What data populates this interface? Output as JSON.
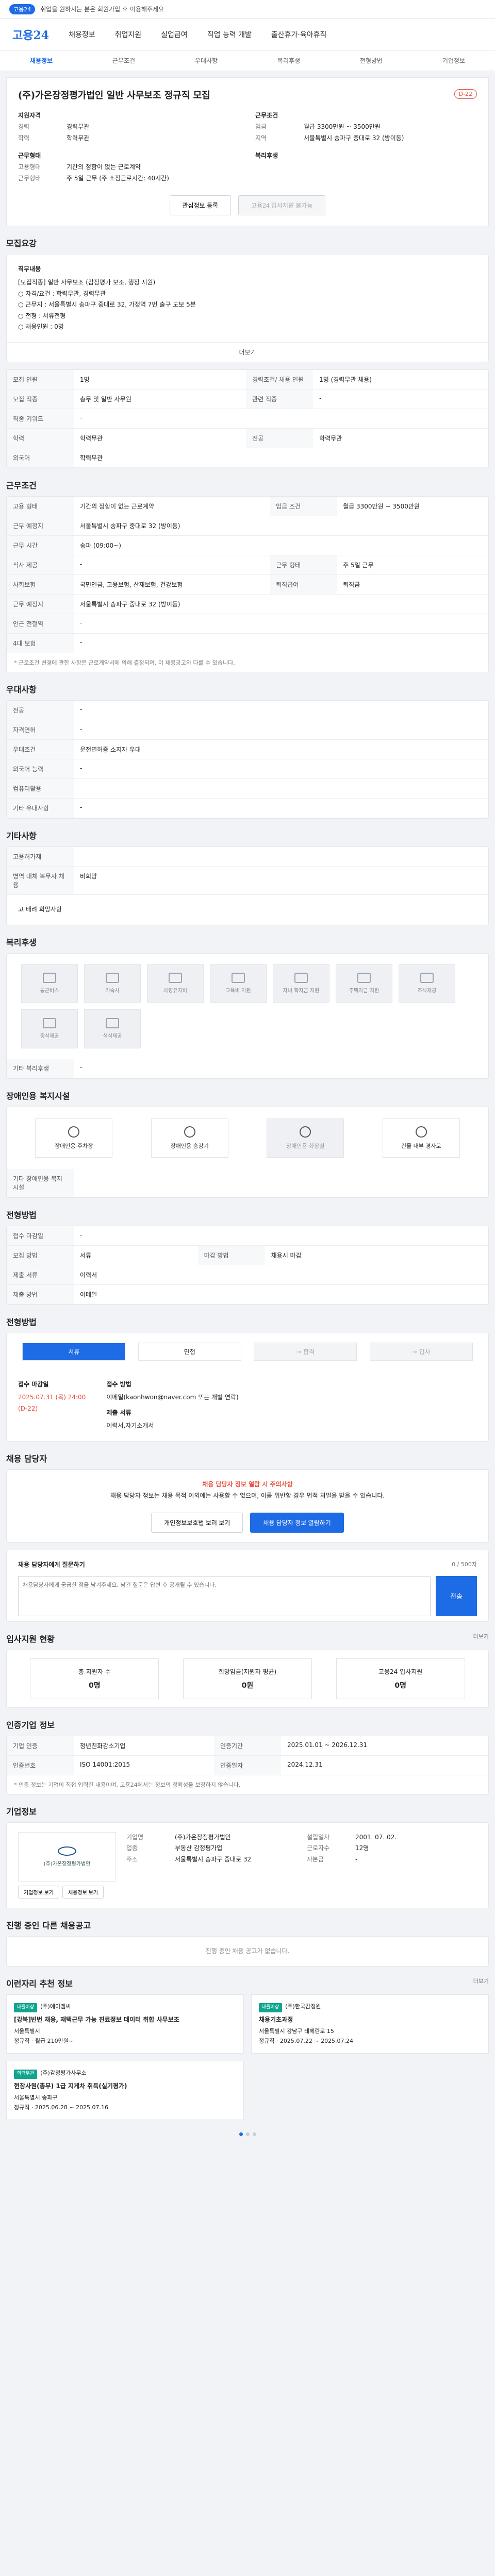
{
  "topbar": {
    "text": "취업을 원하시는 분은 회원가입 후 이용해주세요",
    "pill": "고용24"
  },
  "gnb": {
    "logo": "고용24",
    "menus": [
      "채용정보",
      "취업지원",
      "실업급여",
      "직업 능력 개발",
      "출산휴가·육아휴직"
    ]
  },
  "lnb": {
    "items": [
      "채용정보",
      "근무조건",
      "우대사항",
      "복리후생",
      "전형방법",
      "기업정보"
    ]
  },
  "hero": {
    "title": "(주)가온장정평가법인 일반 사무보조 정규직 모집",
    "dday": "D-22",
    "left_group1_title": "지원자격",
    "left_group1": [
      [
        "경력",
        "경력무관"
      ],
      [
        "학력",
        "학력무관"
      ]
    ],
    "left_group2_title": "근무형태",
    "left_group2": [
      [
        "고용형태",
        "기간의 정함이 없는 근로계약"
      ],
      [
        "근무형태",
        "주 5일 근무 (주 소정근로시간: 40시간)"
      ]
    ],
    "right_group1_title": "근무조건",
    "right_group1": [
      [
        "임금",
        "월급 3300만원 ~ 3500만원"
      ],
      [
        "지역",
        "서울특별시 송파구 중대로 32 (방이동)"
      ]
    ],
    "right_group2_title": "복리후생",
    "scrap_btn": "관심정보 등록",
    "apply_btn": "고용24 입사지원 불가능"
  },
  "job_desc": {
    "title": "모집요강",
    "heading": "직무내용",
    "lines": [
      "[모집직종] 일반 사무보조 (감정평가 보조, 행정 지원)",
      "○ 자격/요건 : 학력무관, 경력무관",
      "○ 근무지 : 서울특별시 송파구 중대로 32, 가정역 7번 출구 도보 5분",
      "○ 전형 : 서류전형",
      "○ 채용인원 : 0명"
    ],
    "more": "더보기"
  },
  "recruit_table": [
    [
      "모집 인원",
      "1명",
      "경력조건/ 채용 인원",
      "1명 (경력무관 채용)"
    ],
    [
      "모집 직종",
      "총무 및 일반 사무원",
      "관련 직종",
      "-"
    ],
    [
      "직종 키워드",
      "-",
      "",
      ""
    ],
    [
      "학력",
      "학력무관",
      "전공",
      "학력무관"
    ],
    [
      "외국어",
      "학력무관",
      "",
      ""
    ]
  ],
  "work_cond": {
    "title": "근무조건",
    "rows": [
      [
        "고용 형태",
        "기간의 정함이 없는 근로계약",
        "임금 조건",
        "월급 3300만원 ~ 3500만원"
      ],
      [
        "근무 예정지",
        "서울특별시 송파구 중대로 32 (방이동)",
        "",
        ""
      ],
      [
        "근무 시간",
        "송파 (09:00~)",
        "",
        ""
      ],
      [
        "식사 제공",
        "-",
        "근무 형태",
        "주 5일 근무"
      ],
      [
        "사회보험",
        "국민연금, 고용보험, 산재보험, 건강보험",
        "퇴직급여",
        "퇴직금"
      ],
      [
        "근무 예정지",
        "서울특별시 송파구 중대로 32 (방이동)",
        "",
        ""
      ],
      [
        "인근 전철역",
        "-",
        "",
        ""
      ],
      [
        "4대 보험",
        "-",
        "",
        ""
      ]
    ],
    "note": "* 근로조건 변경에 관한 사항은 근로계약서에 의해 결정되며, 이 채용공고와 다를 수 있습니다."
  },
  "pref": {
    "title": "우대사항",
    "rows": [
      [
        "전공",
        "-"
      ],
      [
        "자격면허",
        "-"
      ],
      [
        "우대조건",
        "운전면허증 소지자 우대"
      ],
      [
        "외국어 능력",
        "-"
      ],
      [
        "컴퓨터활용",
        "-"
      ],
      [
        "기타 우대사항",
        "-"
      ]
    ]
  },
  "etc": {
    "title": "기타사항",
    "rows": [
      [
        "고용허가제",
        "-"
      ],
      [
        "병역 대체 복무자 채용",
        "비희망"
      ]
    ],
    "handicap": "고 배려 희망사항"
  },
  "welfare": {
    "title": "복리후생",
    "items": [
      "통근버스",
      "기숙사",
      "차량유지비",
      "교육비 지원",
      "자녀 학자금 지원",
      "주택자금 지원",
      "조식제공",
      "중식제공",
      "석식제공"
    ],
    "other_label": "기타 복리후생",
    "other_value": "-"
  },
  "disabled": {
    "title": "장애인용 복지시설",
    "items": [
      "장애인용 주차장",
      "장애인용 승강기",
      "장애인용 화장실",
      "건물 내부 경사로"
    ],
    "other_label": "기타 장애인용 복지시설",
    "other_value": "-"
  },
  "selection": {
    "title": "전형방법",
    "rows": [
      [
        "접수 마감일",
        "-",
        "",
        ""
      ],
      [
        "모집 방법",
        "서류",
        "마감 방법",
        "채용시 마감"
      ],
      [
        "제출 서류",
        "이력서",
        "",
        ""
      ],
      [
        "제출 방법",
        "이메일",
        "",
        ""
      ]
    ]
  },
  "process": {
    "title": "전형방법",
    "steps": [
      "서류",
      "면접",
      "→ 합격 ",
      "→ 입사 "
    ],
    "deadline_label": "접수 마감일",
    "deadline_value": "2025.07.31 (목) 24:00",
    "dday": "(D-22)",
    "method_label": "접수 방법",
    "method_value": "이메일(kaonhwon@naver.com 또는 개별 연락)",
    "doc_label": "제출 서류",
    "doc_value": "이력서,자기소개서"
  },
  "manager": {
    "title": "채용 담당자",
    "warn_red": "채용 담당자 정보 열람 시 주의사항",
    "warn_text": "채용 담당자 정보는 채용 목적 이외에는 사용할 수 없으며, 이를 위반할 경우 법적 처벌을 받을 수 있습니다.",
    "btn1": "개인정보보호법 보러 보기",
    "btn2": "채용 담당자 정보 열람하기"
  },
  "inquiry": {
    "label": "채용 담당자에게 질문하기",
    "placeholder": "채용담당자에게 궁금한 점을 남겨주세요. 남긴 질문은 답변 후 공개될 수 있습니다.",
    "counter": "0 / 500자",
    "send": "전송"
  },
  "applicants": {
    "title": "입사지원 현황",
    "more": "더보기",
    "stats": [
      [
        "총 지원자 수",
        "0명"
      ],
      [
        "희망임금(지원자 평균)",
        "0원"
      ],
      [
        "고용24 입사지원",
        "0명"
      ]
    ]
  },
  "company_info": {
    "title": "인증기업 정보",
    "rows": [
      [
        "기업 인증",
        "청년친화강소기업",
        "인증기간",
        "2025.01.01 ~ 2026.12.31"
      ],
      [
        "인증번호",
        "ISO 14001:2015",
        "인증일자",
        "2024.12.31"
      ]
    ],
    "note": "* 인증 정보는 기업이 직접 입력한 내용이며, 고용24에서는 정보의 정확성을 보장하지 않습니다."
  },
  "company": {
    "title": "기업정보",
    "logo_text": "(주)가온장정평가법인",
    "btn1": "기업정보 보기",
    "btn2": "채용정보 보기",
    "rows": [
      [
        "기업명",
        "(주)가온장정평가법인"
      ],
      [
        "업종",
        "부동산 감정평가업"
      ],
      [
        "주소",
        "서울특별시 송파구 중대로 32"
      ]
    ],
    "rows2": [
      [
        "설립일자",
        "2001. 07. 02."
      ],
      [
        "근로자수",
        "12명"
      ],
      [
        "자본금",
        "-"
      ]
    ]
  },
  "similar": {
    "title": "진행 중인 다른 채용공고",
    "more": "진행 중인 채용 공고가 없습니다."
  },
  "recommend": {
    "title": "이런자리 추천 정보",
    "more": "더보기",
    "cards": [
      {
        "badge": "대졸이상",
        "company": "(주)에이엠씨",
        "title": "[강북]빈번 채용, 재택근무 가능 진료정보 데이터 취합 사무보조",
        "loc": "서울특별시",
        "emp": "정규직",
        "wage": "월급 210만원~"
      },
      {
        "badge": "대졸이상",
        "company": "(주)한국감정원",
        "title": "채용기초과정",
        "loc": "서울특별시 강남구 테헤란로 15",
        "emp": "정규직",
        "wage": "2025.07.22 ~ 2025.07.24"
      },
      {
        "badge": "학력무관",
        "company": "(주)감정평가사무소",
        "title": "현장사원(총무) 1급 지게차 취득(실기평가)",
        "loc": "서울특별시 송파구",
        "emp": "정규직",
        "wage": "2025.06.28 ~ 2025.07.16"
      }
    ]
  }
}
